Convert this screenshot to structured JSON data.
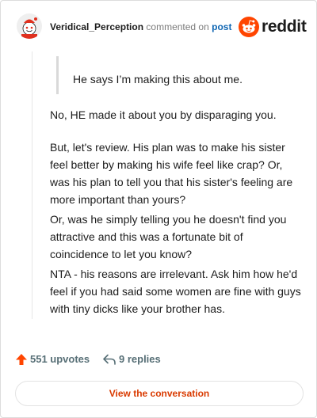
{
  "comment": {
    "username": "Veridical_Perception",
    "action_text": "commented on",
    "post_link": "post",
    "quote": "He says I’m making this about me.",
    "paragraphs": [
      "No, HE made it about you by disparaging you.",
      "But, let's review. His plan was to make his sister feel better by making his wife feel like crap? Or, was his plan to tell you that his sister's feeling are more important than yours?",
      "Or, was he simply telling you he doesn't find you attractive and this was a fortunate bit of coincidence to let you know?",
      "NTA - his reasons are irrelevant. Ask him how he'd feel if you had said some women are fine with guys with tiny dicks like your brother has."
    ]
  },
  "brand": {
    "wordmark": "reddit",
    "accent_color": "#ff4500"
  },
  "footer": {
    "upvotes": "551 upvotes",
    "replies": "9 replies",
    "view_button": "View the conversation"
  },
  "icons": {
    "avatar": "snoo-avatar-icon",
    "logo": "reddit-logo-icon",
    "upvote": "upvote-arrow-icon",
    "reply": "reply-arrow-icon"
  }
}
